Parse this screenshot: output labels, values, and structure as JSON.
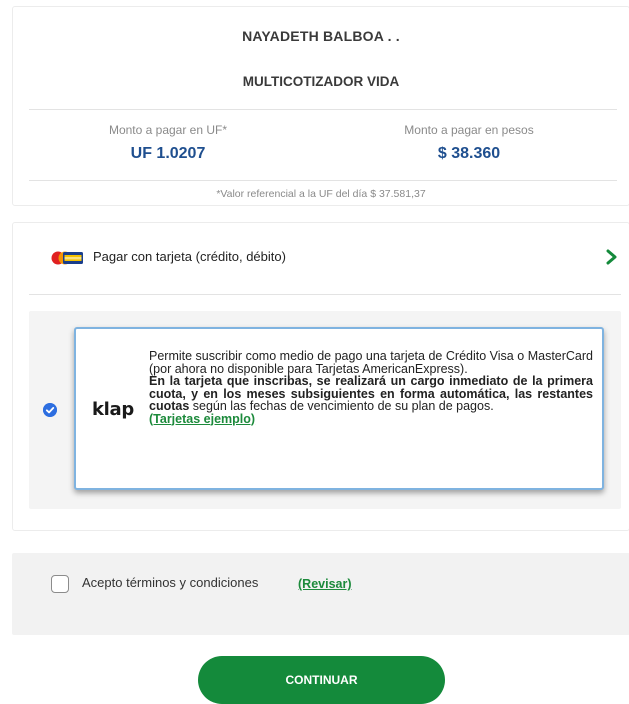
{
  "header": {
    "name": "NAYADETH BALBOA . .",
    "product": "MULTICOTIZADOR VIDA"
  },
  "amounts": {
    "uf_label": "Monto a pagar en UF*",
    "uf_value": "UF 1.0207",
    "pesos_label": "Monto a pagar en pesos",
    "pesos_value": "$ 38.360",
    "reference_note": "*Valor referencial a la UF del día $ 37.581,37"
  },
  "payment": {
    "method_label": "Pagar con tarjeta (crédito, débito)",
    "icons": [
      "credit-card-brand-icon",
      "chevron-right-icon",
      "check-circle-icon"
    ],
    "klap": {
      "logo": "klap",
      "text_intro": "Permite suscribir como medio de pago una tarjeta de Crédito Visa o MasterCard (por ahora no disponible para Tarjetas AmericanExpress).",
      "text_bold1": "En la tarjeta que inscribas, se realizará un cargo inmediato de la primera cuota, y en los meses subsiguientes en forma automática, las restantes cuotas",
      "text_rest": " según las fechas de vencimiento de su plan de pagos.",
      "link": "(Tarjetas ejemplo)"
    }
  },
  "terms": {
    "label": "Acepto términos y condiciones",
    "link": "(Revisar)"
  },
  "continue_label": "CONTINUAR",
  "colors": {
    "accent_green": "#148a3b",
    "amount_blue": "#1f4f8f",
    "check_blue": "#2d6ee0"
  }
}
